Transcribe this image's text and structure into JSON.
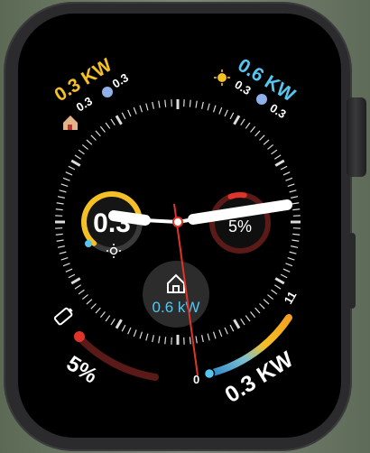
{
  "top_left": {
    "power": "0.3 KW",
    "sub1": "0.3",
    "sub2": "0.3",
    "sub3": "0.3"
  },
  "top_right": {
    "power": "0.6 KW",
    "sub1": "0.3",
    "sub2": "0.3",
    "sub3": "0.3"
  },
  "left_gauge": {
    "value": "0.3",
    "level": 0.6
  },
  "right_gauge": {
    "value": "5%",
    "level": 0.05
  },
  "center": {
    "value": "0.6 kW"
  },
  "bottom_left": {
    "value": "5%",
    "level": 0.05
  },
  "bottom_right": {
    "value": "0.3 KW",
    "min": "0",
    "max": "11",
    "level": 0.03
  },
  "colors": {
    "yellow": "#f4c025",
    "cyan": "#56c6f0",
    "red": "#e0342a",
    "darkred": "#5a1a17"
  },
  "icons": [
    "house-icon",
    "globe-icon",
    "sun-icon",
    "battery-icon"
  ]
}
